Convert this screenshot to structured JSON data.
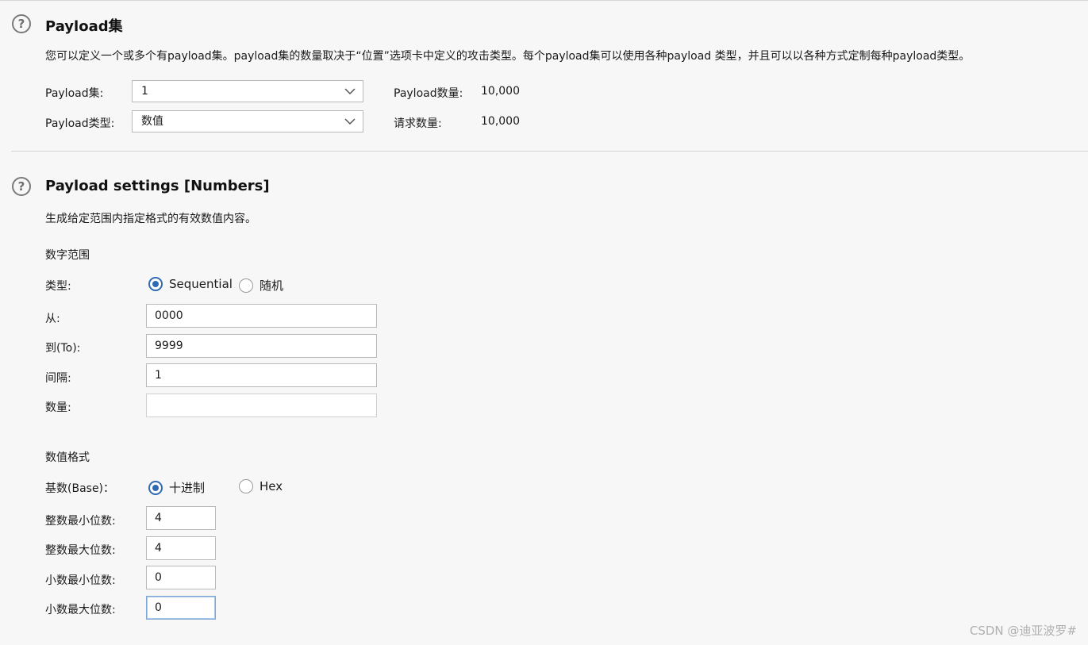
{
  "payload_sets": {
    "title": "Payload集",
    "description": "您可以定义一个或多个有payload集。payload集的数量取决于“位置”选项卡中定义的攻击类型。每个payload集可以使用各种payload 类型，并且可以以各种方式定制每种payload类型。",
    "set_label": "Payload集:",
    "set_value": "1",
    "type_label": "Payload类型:",
    "type_value": "数值",
    "count_label": "Payload数量:",
    "count_value": "10,000",
    "requests_label": "请求数量:",
    "requests_value": "10,000"
  },
  "payload_settings": {
    "title": "Payload settings [Numbers]",
    "description": "生成给定范围内指定格式的有效数值内容。",
    "range_heading": "数字范围",
    "type_label": "类型:",
    "type_options": [
      "Sequential",
      "随机"
    ],
    "type_selected": "Sequential",
    "from_label": "从:",
    "from_value": "0000",
    "to_label": "到(To):",
    "to_value": "9999",
    "step_label": "间隔:",
    "step_value": "1",
    "howmany_label": "数量:",
    "howmany_value": "",
    "format_heading": "数值格式",
    "base_label": "基数(Base)：",
    "base_options": [
      "十进制",
      "Hex"
    ],
    "base_selected": "十进制",
    "min_int_label": "整数最小位数:",
    "min_int_value": "4",
    "max_int_label": "整数最大位数:",
    "max_int_value": "4",
    "min_frac_label": "小数最小位数:",
    "min_frac_value": "0",
    "max_frac_label": "小数最大位数:",
    "max_frac_value": "0"
  },
  "watermark": "CSDN @迪亚波罗#",
  "colors": {
    "accent": "#2f6ab3",
    "background": "#f7f7f7",
    "border": "#b9b9b9"
  },
  "icons": {
    "help": "help-icon",
    "dropdown": "chevron-down-icon"
  }
}
